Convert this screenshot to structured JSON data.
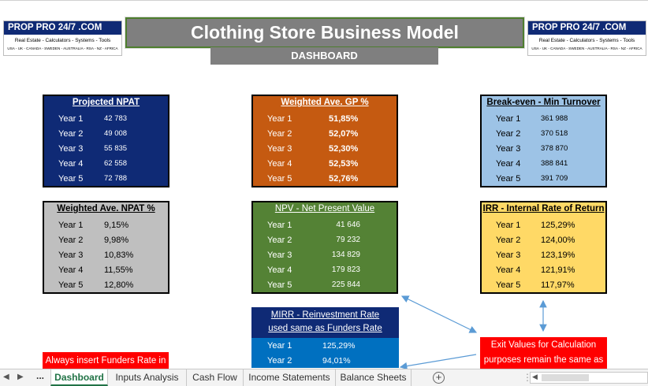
{
  "logo": {
    "name": "PROP PRO 24/7 .COM",
    "tagline": "Real Estate - Calculators - Systems - Tools",
    "countries": "USA - UK - CANADA - SWEDEN - AUSTRALIA - RSA - NZ - AFRICA"
  },
  "header": {
    "title": "Clothing Store Business Model",
    "subtitle": "DASHBOARD"
  },
  "cards": {
    "projected_npat": {
      "title": "Projected NPAT",
      "rows": [
        {
          "year": "Year 1",
          "value": "42 783"
        },
        {
          "year": "Year 2",
          "value": "49 008"
        },
        {
          "year": "Year 3",
          "value": "55 835"
        },
        {
          "year": "Year 4",
          "value": "62 558"
        },
        {
          "year": "Year 5",
          "value": "72 788"
        }
      ]
    },
    "weighted_gp": {
      "title": "Weighted Ave. GP %",
      "rows": [
        {
          "year": "Year 1",
          "value": "51,85%"
        },
        {
          "year": "Year 2",
          "value": "52,07%"
        },
        {
          "year": "Year 3",
          "value": "52,30%"
        },
        {
          "year": "Year 4",
          "value": "52,53%"
        },
        {
          "year": "Year 5",
          "value": "52,76%"
        }
      ]
    },
    "break_even": {
      "title": "Break-even - Min Turnover",
      "rows": [
        {
          "year": "Year 1",
          "value": "361 988"
        },
        {
          "year": "Year 2",
          "value": "370 518"
        },
        {
          "year": "Year 3",
          "value": "378 870"
        },
        {
          "year": "Year 4",
          "value": "388 841"
        },
        {
          "year": "Year 5",
          "value": "391 709"
        }
      ]
    },
    "weighted_npat": {
      "title": "Weighted Ave. NPAT %",
      "rows": [
        {
          "year": "Year 1",
          "value": "9,15%"
        },
        {
          "year": "Year 2",
          "value": "9,98%"
        },
        {
          "year": "Year 3",
          "value": "10,83%"
        },
        {
          "year": "Year 4",
          "value": "11,55%"
        },
        {
          "year": "Year 5",
          "value": "12,80%"
        }
      ]
    },
    "npv": {
      "title": "NPV - Net Present Value",
      "rows": [
        {
          "year": "Year 1",
          "value": "41 646"
        },
        {
          "year": "Year 2",
          "value": "79 232"
        },
        {
          "year": "Year 3",
          "value": "134 829"
        },
        {
          "year": "Year 4",
          "value": "179 823"
        },
        {
          "year": "Year 5",
          "value": "225 844"
        }
      ]
    },
    "irr": {
      "title": "IRR - Internal Rate of Return",
      "rows": [
        {
          "year": "Year 1",
          "value": "125,29%"
        },
        {
          "year": "Year 2",
          "value": "124,00%"
        },
        {
          "year": "Year 3",
          "value": "123,19%"
        },
        {
          "year": "Year 4",
          "value": "121,91%"
        },
        {
          "year": "Year 5",
          "value": "117,97%"
        }
      ]
    },
    "mirr": {
      "title_line1": "MIRR - Reinvestment Rate",
      "title_line2": "used same as Funders Rate",
      "rows": [
        {
          "year": "Year 1",
          "value": "125,29%"
        },
        {
          "year": "Year 2",
          "value": "94,01%"
        }
      ]
    }
  },
  "notes": {
    "funders_rate": "Always insert Funders Rate in",
    "exit_values_line1": "Exit Values for Calculation",
    "exit_values_line2": "purposes remain the same as"
  },
  "tabbar": {
    "more": "...",
    "add": "+",
    "tabs": [
      {
        "label": "Dashboard",
        "active": true
      },
      {
        "label": "Inputs Analysis",
        "active": false
      },
      {
        "label": "Cash Flow",
        "active": false
      },
      {
        "label": "Income Statements",
        "active": false
      },
      {
        "label": "Balance Sheets",
        "active": false
      }
    ]
  },
  "colors": {
    "navy": "#0f2a75",
    "orange": "#c55a11",
    "light_blue": "#9dc3e6",
    "grey": "#bfbfbf",
    "green": "#548235",
    "yellow": "#ffd966",
    "blue": "#0070c0",
    "red": "#ff0000",
    "excel_green": "#217346"
  }
}
